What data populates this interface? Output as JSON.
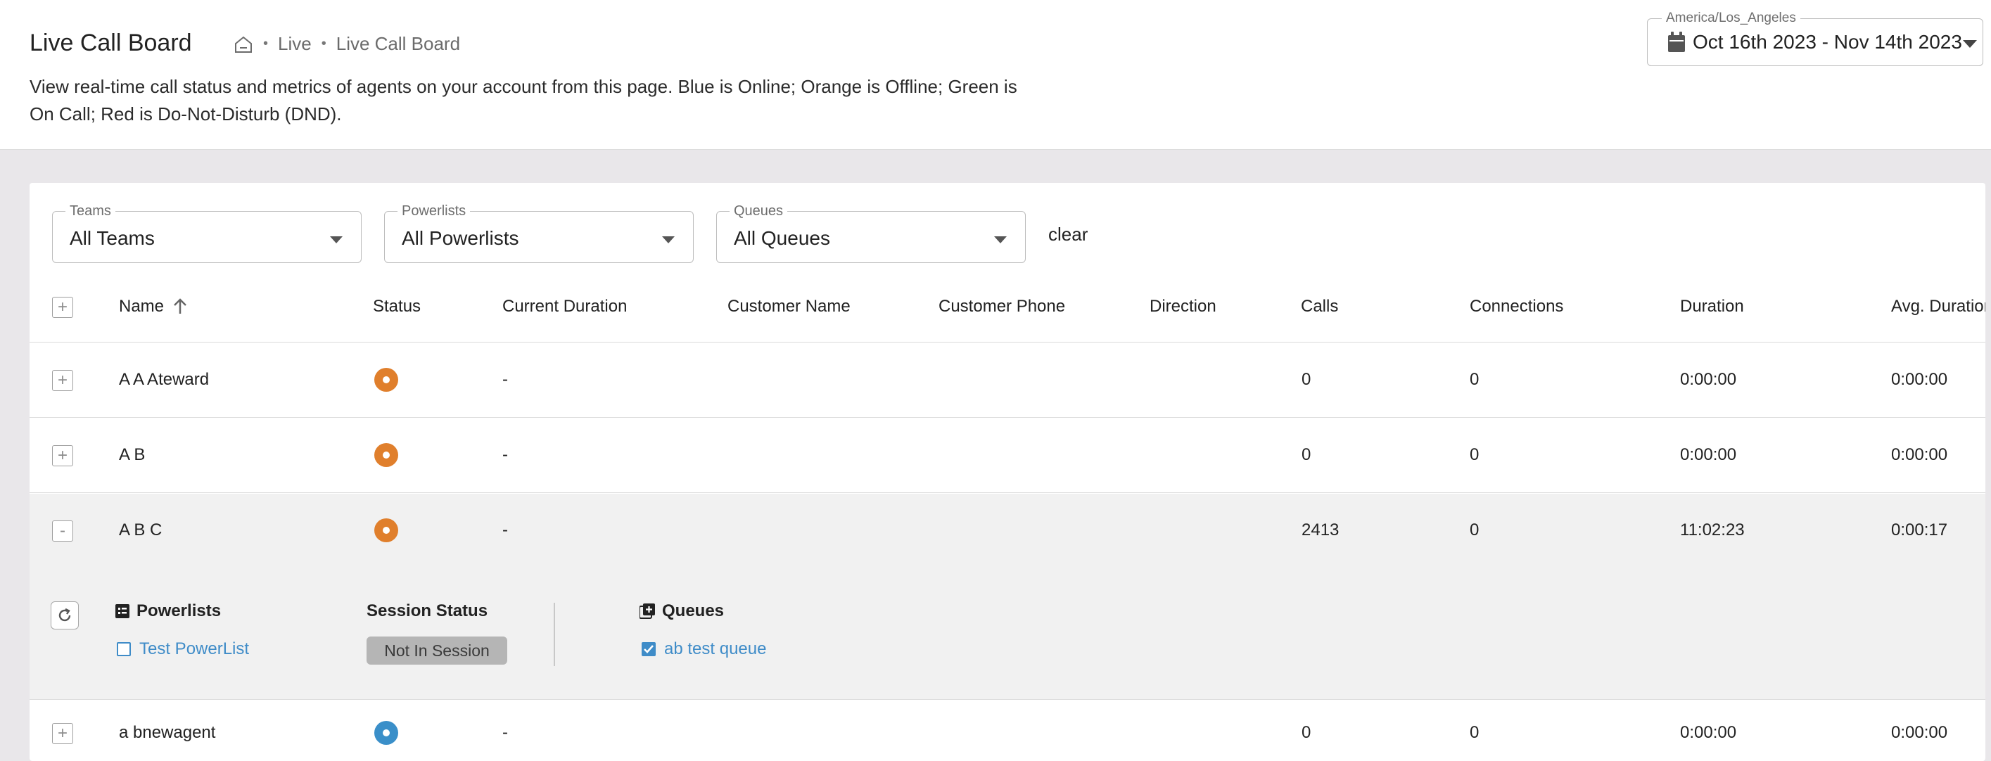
{
  "header": {
    "title": "Live Call Board",
    "breadcrumb": [
      "Live",
      "Live Call Board"
    ],
    "description": "View real-time call status and metrics of agents on your account from this page. Blue is Online; Orange is Offline; Green is On Call; Red is Do-Not-Disturb (DND).",
    "timezone_label": "America/Los_Angeles",
    "date_range": "Oct 16th 2023 - Nov 14th 2023"
  },
  "filters": {
    "teams": {
      "label": "Teams",
      "value": "All Teams"
    },
    "powerlists": {
      "label": "Powerlists",
      "value": "All Powerlists"
    },
    "queues": {
      "label": "Queues",
      "value": "All Queues"
    },
    "clear_label": "clear"
  },
  "table": {
    "columns": [
      "Name",
      "Status",
      "Current Duration",
      "Customer Name",
      "Customer Phone",
      "Direction",
      "Calls",
      "Connections",
      "Duration",
      "Avg. Duration"
    ],
    "rows": [
      {
        "expander": "+",
        "name": "A A Ateward",
        "status": "offline",
        "current_duration": "-",
        "customer_name": "",
        "customer_phone": "",
        "direction": "",
        "calls": "0",
        "connections": "0",
        "duration": "0:00:00",
        "avg_duration": "0:00:00"
      },
      {
        "expander": "+",
        "name": "A B",
        "status": "offline",
        "current_duration": "-",
        "customer_name": "",
        "customer_phone": "",
        "direction": "",
        "calls": "0",
        "connections": "0",
        "duration": "0:00:00",
        "avg_duration": "0:00:00"
      },
      {
        "expander": "-",
        "name": "A B C",
        "status": "offline",
        "current_duration": "-",
        "customer_name": "",
        "customer_phone": "",
        "direction": "",
        "calls": "2413",
        "connections": "0",
        "duration": "11:02:23",
        "avg_duration": "0:00:17"
      },
      {
        "expander": "+",
        "name": "a bnewagent",
        "status": "online",
        "current_duration": "-",
        "customer_name": "",
        "customer_phone": "",
        "direction": "",
        "calls": "0",
        "connections": "0",
        "duration": "0:00:00",
        "avg_duration": "0:00:00"
      }
    ]
  },
  "detail": {
    "powerlists_title": "Powerlists",
    "powerlist_item": "Test PowerList",
    "session_status_title": "Session Status",
    "session_status_value": "Not In Session",
    "queues_title": "Queues",
    "queue_item": "ab test queue"
  },
  "colors": {
    "offline": "#e07f2c",
    "online": "#3a8fc9",
    "link": "#3f8cc8"
  },
  "icons": {
    "breadcrumb_home": "home-icon",
    "date_picker": "calendar-icon",
    "sort": "arrow-up-icon",
    "refresh": "refresh-icon",
    "powerlists": "list-icon",
    "queues": "add-box-icon"
  }
}
